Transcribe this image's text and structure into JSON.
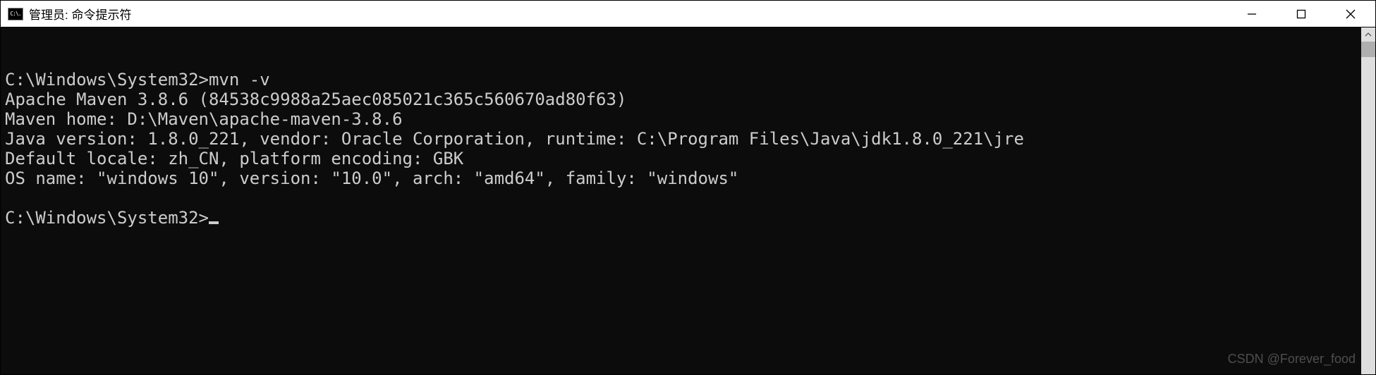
{
  "window": {
    "icon_glyph": "C:\\.",
    "title": "管理员: 命令提示符"
  },
  "terminal": {
    "lines": {
      "l0_prompt": "C:\\Windows\\System32>",
      "l0_cmd": "mvn -v",
      "l1": "Apache Maven 3.8.6 (84538c9988a25aec085021c365c560670ad80f63)",
      "l2": "Maven home: D:\\Maven\\apache-maven-3.8.6",
      "l3": "Java version: 1.8.0_221, vendor: Oracle Corporation, runtime: C:\\Program Files\\Java\\jdk1.8.0_221\\jre",
      "l4": "Default locale: zh_CN, platform encoding: GBK",
      "l5": "OS name: \"windows 10\", version: \"10.0\", arch: \"amd64\", family: \"windows\"",
      "l6": "",
      "l7_prompt": "C:\\Windows\\System32>"
    }
  },
  "watermark": "CSDN @Forever_food"
}
